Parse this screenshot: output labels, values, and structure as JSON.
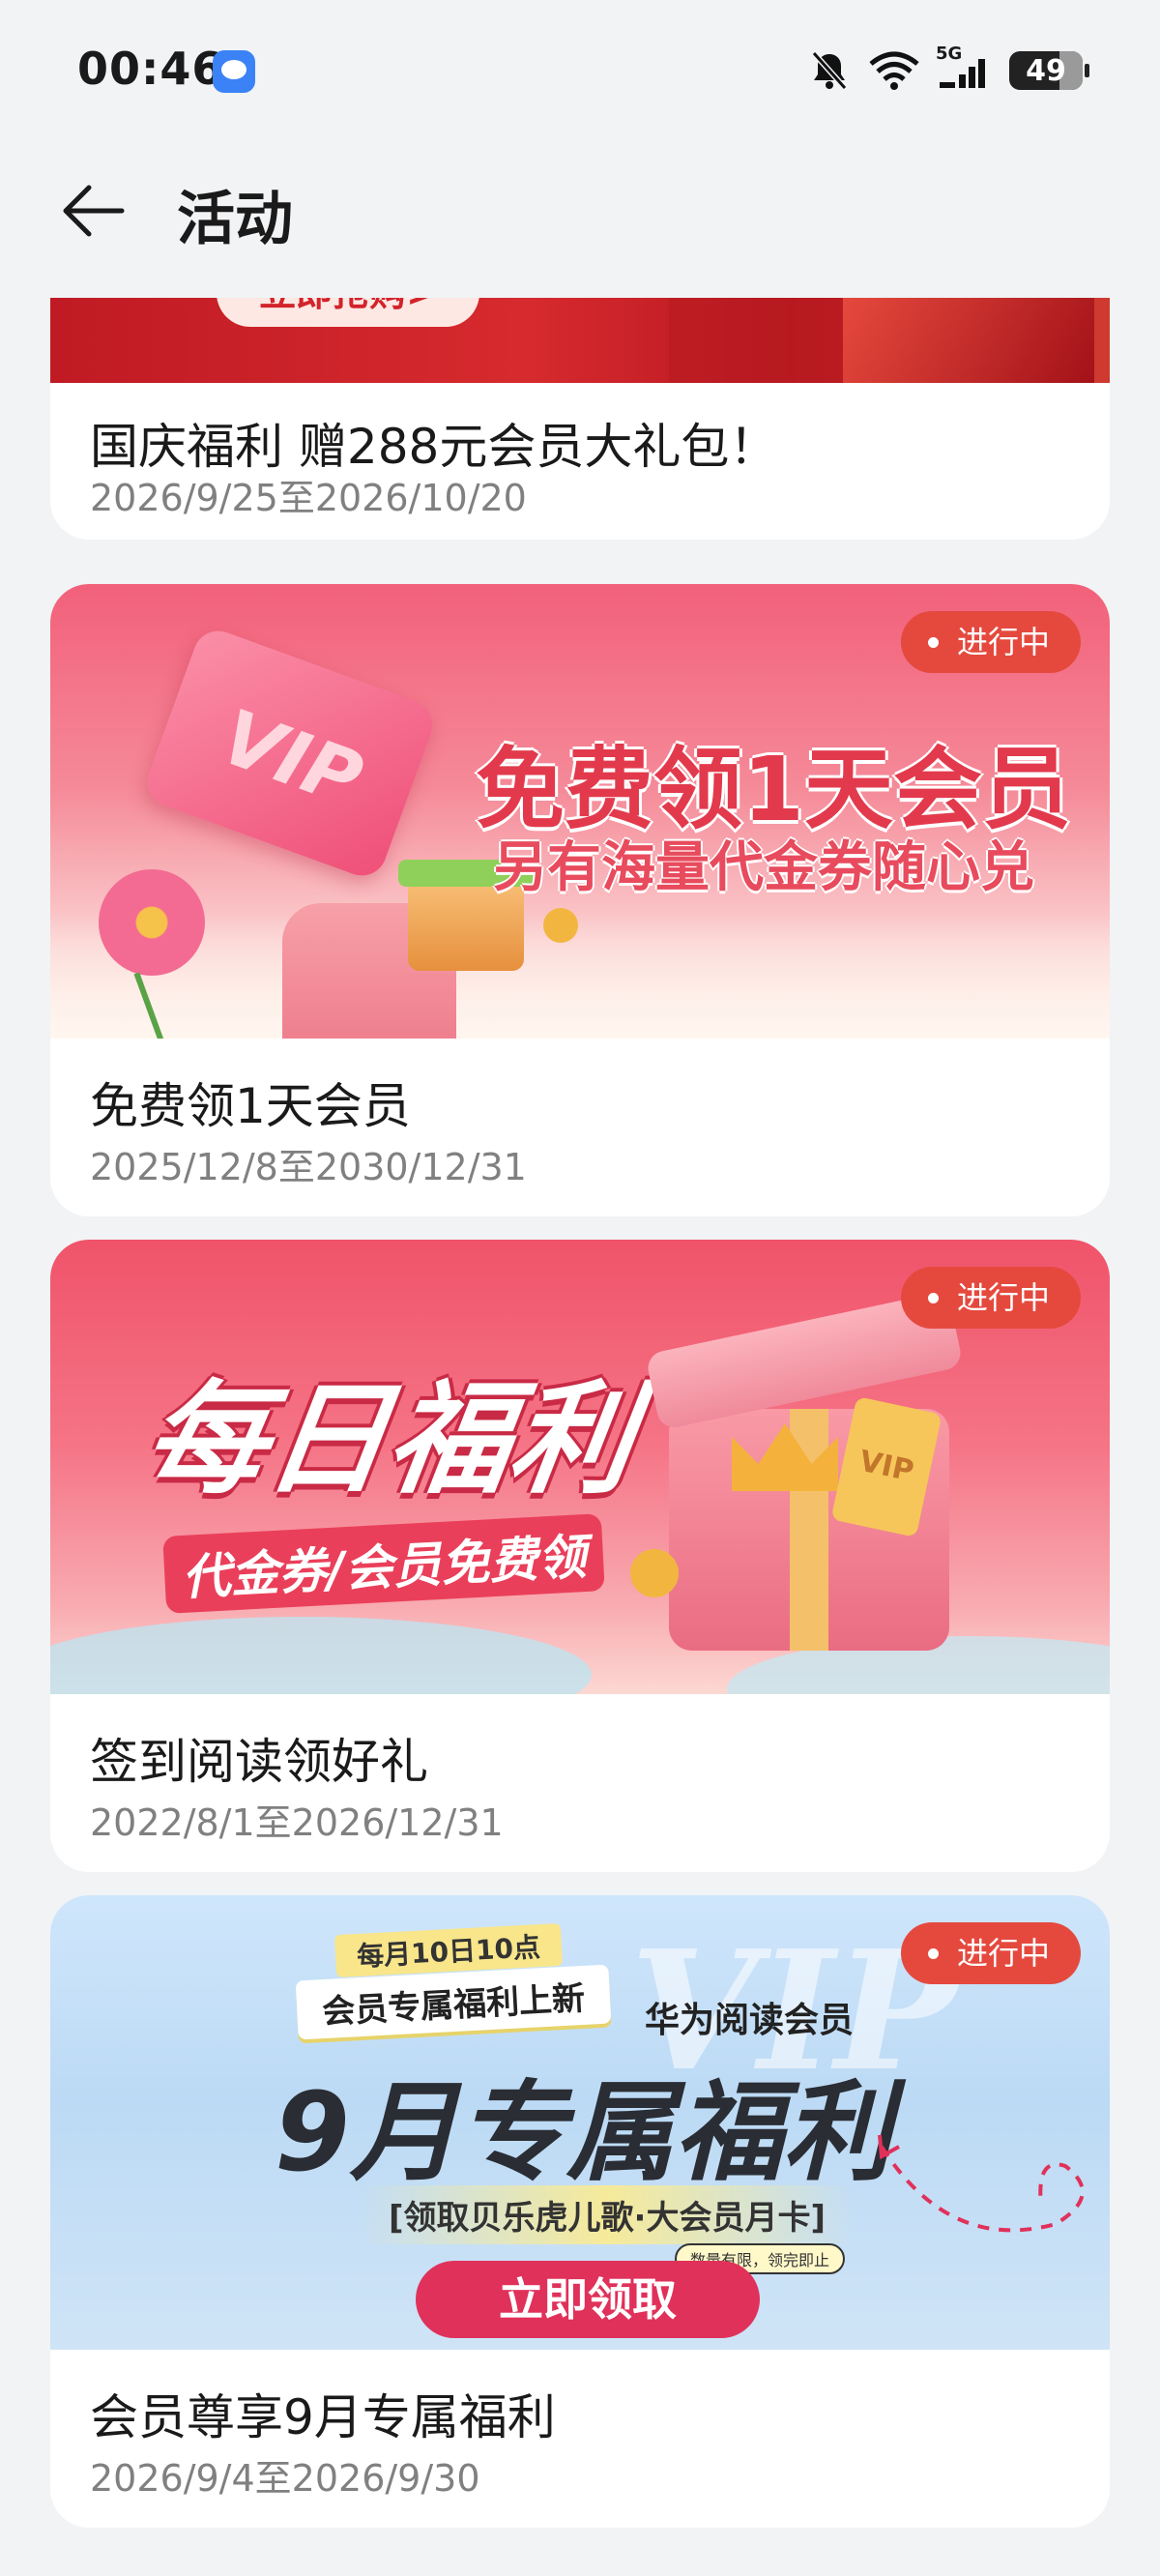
{
  "status_bar": {
    "time": "00:46",
    "network": "5G",
    "battery": "49"
  },
  "header": {
    "title": "活动"
  },
  "activities": [
    {
      "title": "国庆福利 赠288元会员大礼包！",
      "date": "2026/9/25至2026/10/20",
      "banner_button": "立即抢购>"
    },
    {
      "title": "免费领1天会员",
      "date": "2025/12/8至2030/12/31",
      "status": "进行中",
      "banner": {
        "headline": "免费领1天会员",
        "subline": "另有海量代金券随心兑",
        "card_text": "VIP"
      }
    },
    {
      "title": "签到阅读领好礼",
      "date": "2022/8/1至2026/12/31",
      "status": "进行中",
      "banner": {
        "headline": "每日福利",
        "subline": "代金券/会员免费领",
        "box_text": "VIP"
      }
    },
    {
      "title": "会员尊享9月专属福利",
      "date": "2026/9/4至2026/9/30",
      "status": "进行中",
      "banner": {
        "tag_top": "每月10日10点",
        "tag_main": "会员专属福利上新",
        "brand": "华为阅读会员",
        "watermark": "VIP",
        "headline": "9月专属福利",
        "offer": "[领取贝乐虎儿歌·大会员月卡]",
        "note": "数量有限，领完即止",
        "button": "立即领取"
      }
    }
  ],
  "colors": {
    "badge": "#e5493e",
    "accent_red": "#d93a48",
    "background": "#f1f3f5"
  }
}
